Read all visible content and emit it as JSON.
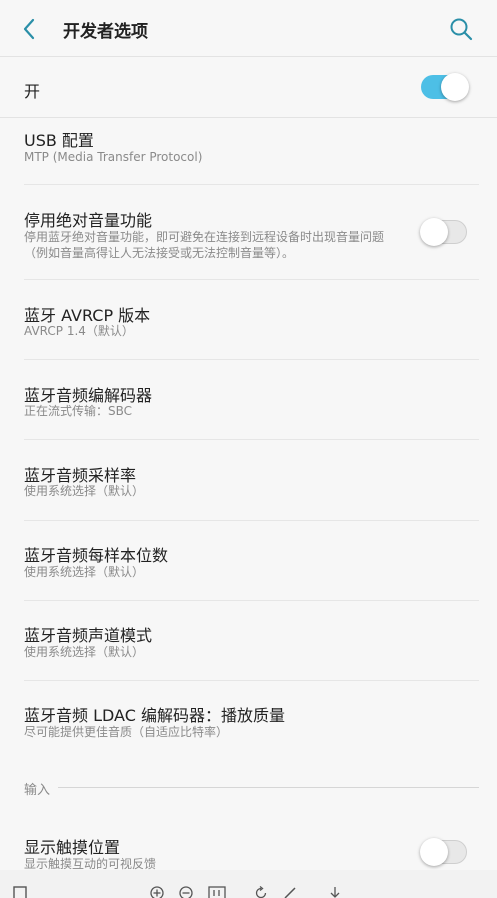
{
  "appbar": {
    "title": "开发者选项",
    "back_icon": "back-chevron-icon",
    "search_icon": "search-icon"
  },
  "master_switch": {
    "label": "开",
    "on": true
  },
  "items": [
    {
      "title": "USB 配置",
      "subtitle": "MTP (Media Transfer Protocol)"
    },
    {
      "title": "停用绝对音量功能",
      "subtitle_line1": "停用蓝牙绝对音量功能，即可避免在连接到远程设备时出现音量问题",
      "subtitle_line2": "（例如音量高得让人无法接受或无法控制音量等）。",
      "toggle_on": false
    },
    {
      "title": "蓝牙 AVRCP 版本",
      "subtitle": "AVRCP 1.4（默认）"
    },
    {
      "title": "蓝牙音频编解码器",
      "subtitle": "正在流式传输：SBC"
    },
    {
      "title": "蓝牙音频采样率",
      "subtitle": "使用系统选择（默认）"
    },
    {
      "title": "蓝牙音频每样本位数",
      "subtitle": "使用系统选择（默认）"
    },
    {
      "title": "蓝牙音频声道模式",
      "subtitle": "使用系统选择（默认）"
    },
    {
      "title": "蓝牙音频 LDAC 编解码器：播放质量",
      "subtitle": "尽可能提供更佳音质（自适应比特率）"
    }
  ],
  "input_section": {
    "header": "输入",
    "items": [
      {
        "title": "显示触摸位置",
        "subtitle": "显示触摸互动的可视反馈",
        "toggle_on": false
      }
    ]
  },
  "colors": {
    "accent": "#4dbfe6",
    "icon_teal": "#2a8fa8"
  }
}
